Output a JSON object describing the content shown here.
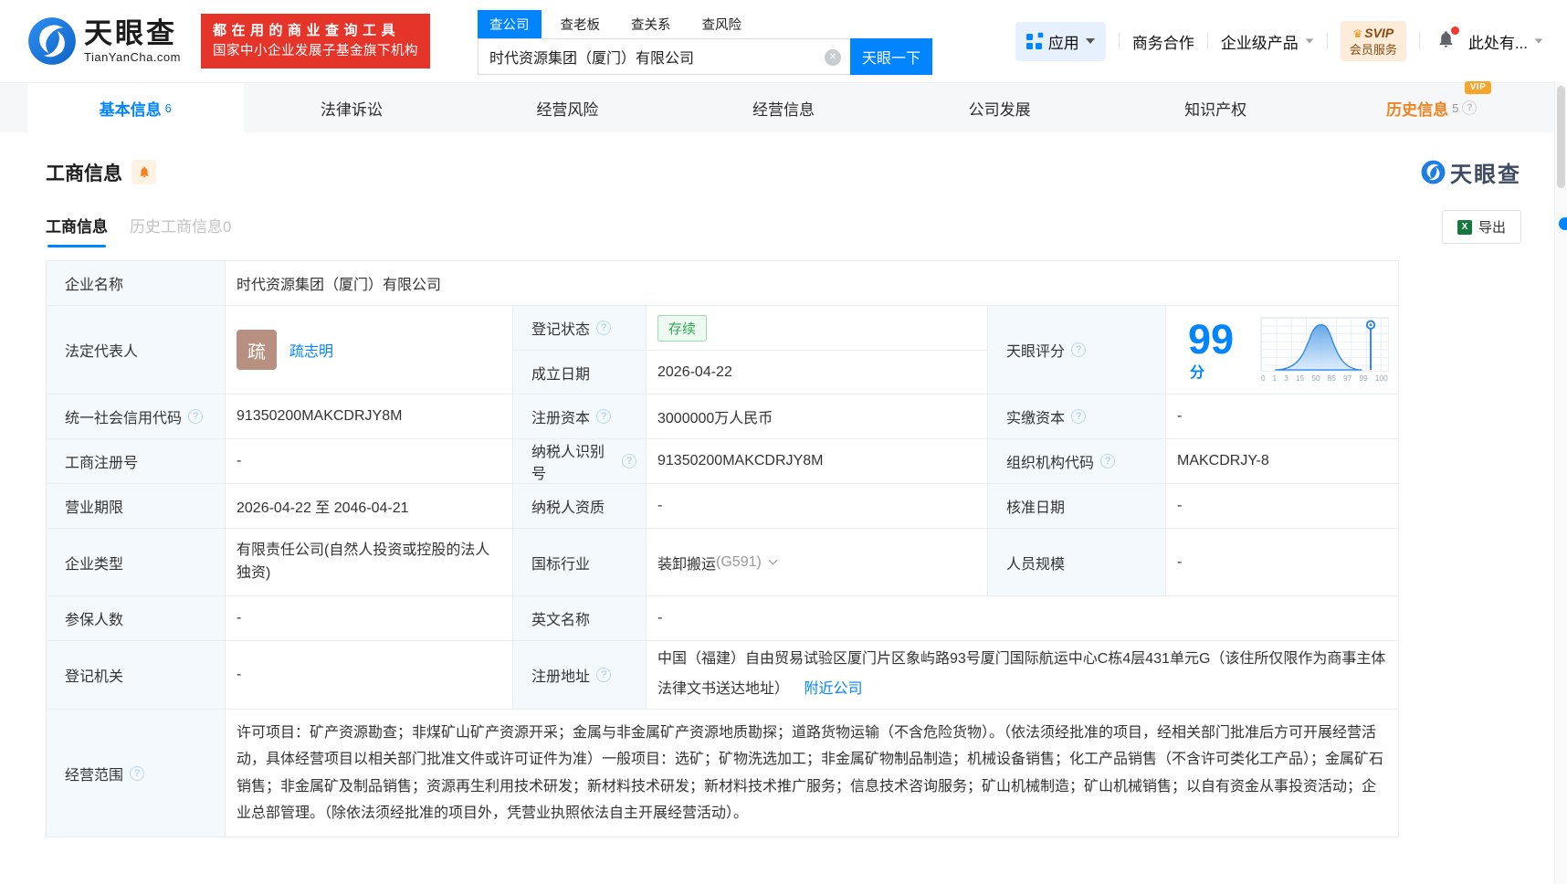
{
  "header": {
    "logo": {
      "brand": "天眼查",
      "domain": "TianYanCha.com"
    },
    "slogan": {
      "line1": "都在用的商业查询工具",
      "line2": "国家中小企业发展子基金旗下机构"
    },
    "search": {
      "tabs": [
        {
          "label": "查公司",
          "active": true
        },
        {
          "label": "查老板",
          "active": false
        },
        {
          "label": "查关系",
          "active": false
        },
        {
          "label": "查风险",
          "active": false
        }
      ],
      "value": "时代资源集团（厦门）有限公司",
      "button": "天眼一下"
    },
    "nav": {
      "apps": "应用",
      "cooperation": "商务合作",
      "enterprise": "企业级产品",
      "svip_line1": "SVIP",
      "svip_line2": "会员服务",
      "user": "此处有..."
    }
  },
  "tabs": [
    {
      "label": "基本信息",
      "count": "6",
      "active": true
    },
    {
      "label": "法律诉讼"
    },
    {
      "label": "经营风险"
    },
    {
      "label": "经营信息"
    },
    {
      "label": "公司发展"
    },
    {
      "label": "知识产权"
    },
    {
      "label": "历史信息",
      "count": "5",
      "vip": "VIP"
    }
  ],
  "section": {
    "title": "工商信息",
    "watermark": "天眼查",
    "subtabs": [
      {
        "label": "工商信息",
        "active": true
      },
      {
        "label": "历史工商信息0",
        "active": false
      }
    ],
    "export_label": "导出"
  },
  "biz": {
    "company_name_label": "企业名称",
    "company_name": "时代资源集团（厦门）有限公司",
    "legal_rep_label": "法定代表人",
    "legal_rep_avatar": "疏",
    "legal_rep_name": "疏志明",
    "reg_status_label": "登记状态",
    "reg_status": "存续",
    "est_date_label": "成立日期",
    "est_date": "2026-04-22",
    "score_label": "天眼评分",
    "credit_code_label": "统一社会信用代码",
    "credit_code": "91350200MAKCDRJY8M",
    "reg_capital_label": "注册资本",
    "reg_capital": "3000000万人民币",
    "paid_capital_label": "实缴资本",
    "paid_capital": "-",
    "reg_number_label": "工商注册号",
    "reg_number": "-",
    "taxpayer_id_label": "纳税人识别号",
    "taxpayer_id": "91350200MAKCDRJY8M",
    "org_code_label": "组织机构代码",
    "org_code": "MAKCDRJY-8",
    "business_term_label": "营业期限",
    "business_term": "2026-04-22 至 2046-04-21",
    "taxpayer_quality_label": "纳税人资质",
    "taxpayer_quality": "-",
    "approval_date_label": "核准日期",
    "approval_date": "-",
    "company_type_label": "企业类型",
    "company_type": "有限责任公司(自然人投资或控股的法人独资)",
    "industry_label": "国标行业",
    "industry": "装卸搬运",
    "industry_code": "(G591)",
    "staff_size_label": "人员规模",
    "staff_size": "-",
    "insured_label": "参保人数",
    "insured": "-",
    "english_name_label": "英文名称",
    "english_name": "-",
    "reg_authority_label": "登记机关",
    "reg_authority": "-",
    "reg_address_label": "注册地址",
    "reg_address": "中国（福建）自由贸易试验区厦门片区象屿路93号厦门国际航运中心C栋4层431单元G（该住所仅限作为商事主体法律文书送达地址）",
    "nearby_link": "附近公司",
    "business_scope_label": "经营范围",
    "business_scope": "许可项目：矿产资源勘查；非煤矿山矿产资源开采；金属与非金属矿产资源地质勘探；道路货物运输（不含危险货物）。（依法须经批准的项目，经相关部门批准后方可开展经营活动，具体经营项目以相关部门批准文件或许可证件为准）一般项目：选矿；矿物洗选加工；非金属矿物制品制造；机械设备销售；化工产品销售（不含许可类化工产品）；金属矿石销售；非金属矿及制品销售；资源再生利用技术研发；新材料技术研发；新材料技术推广服务；信息技术咨询服务；矿山机械制造；矿山机械销售；以自有资金从事投资活动；企业总部管理。（除依法须经批准的项目外，凭营业执照依法自主开展经营活动）。"
  },
  "chart_data": {
    "type": "area",
    "title": "天眼评分",
    "score": "99",
    "score_unit": "分",
    "x_ticks": [
      "0",
      "1",
      "3",
      "15",
      "50",
      "85",
      "97",
      "99",
      "100"
    ],
    "curve_points": [
      {
        "x": 0,
        "y": 0
      },
      {
        "x": 1,
        "y": 0.02
      },
      {
        "x": 3,
        "y": 0.08
      },
      {
        "x": 15,
        "y": 0.45
      },
      {
        "x": 50,
        "y": 1.0
      },
      {
        "x": 85,
        "y": 0.45
      },
      {
        "x": 97,
        "y": 0.08
      },
      {
        "x": 99,
        "y": 0.02
      },
      {
        "x": 100,
        "y": 0
      }
    ],
    "marker_x": 99,
    "grid": true,
    "line_color": "#2e86e0",
    "fill_color": "#8fc0f0"
  },
  "colors": {
    "primary_blue": "#0084ff",
    "brand_red": "#e5342a",
    "vip_orange": "#f5a42c",
    "history_tab_orange": "#ee8422",
    "status_green": "#34a853",
    "label_cell_bg": "#f3f9fd",
    "avatar_bg": "#b8907f"
  }
}
